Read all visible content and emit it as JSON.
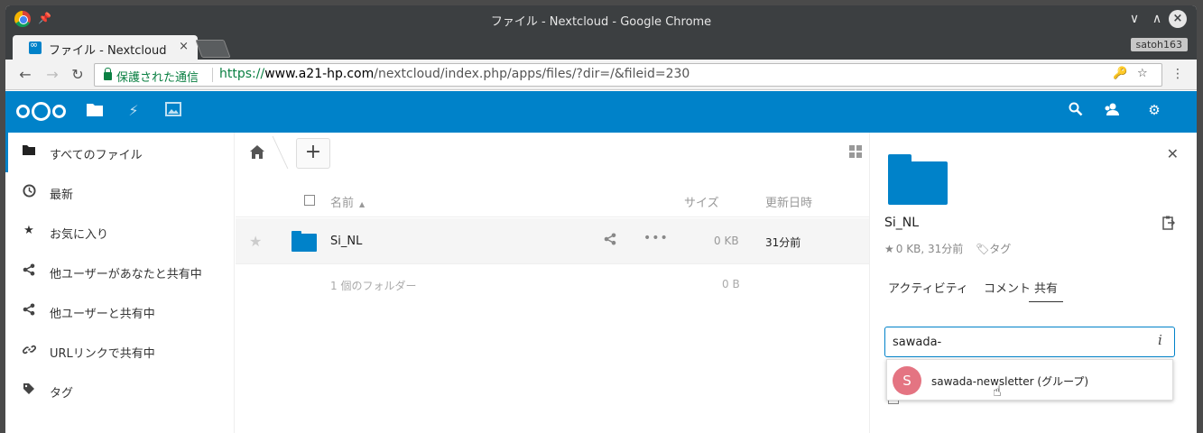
{
  "window": {
    "title": "ファイル - Nextcloud - Google Chrome",
    "controls": [
      "chevron-down",
      "chevron-up",
      "close"
    ]
  },
  "tab": {
    "title": "ファイル - Nextcloud",
    "close": "×"
  },
  "profile": "satoh163",
  "address": {
    "secure_label": "保護された通信",
    "scheme": "https://",
    "host": "www.a21-hp.com",
    "path": "/nextcloud/index.php/apps/files/?dir=/&fileid=230"
  },
  "nc_header": {
    "apps": [
      "files-icon",
      "activity-icon",
      "gallery-icon"
    ],
    "right": [
      "search-icon",
      "contacts-icon",
      "settings-icon"
    ],
    "brand_color": "#0082c9"
  },
  "sidebar": {
    "items": [
      {
        "label": "すべてのファイル",
        "icon": "folder-icon",
        "active": true
      },
      {
        "label": "最新",
        "icon": "clock-icon"
      },
      {
        "label": "お気に入り",
        "icon": "star-icon"
      },
      {
        "label": "他ユーザーがあなたと共有中",
        "icon": "share-icon"
      },
      {
        "label": "他ユーザーと共有中",
        "icon": "share-icon"
      },
      {
        "label": "URLリンクで共有中",
        "icon": "link-icon"
      },
      {
        "label": "タグ",
        "icon": "tag-icon"
      }
    ]
  },
  "files": {
    "add_label": "+",
    "columns": {
      "name": "名前",
      "size": "サイズ",
      "modified": "更新日時"
    },
    "rows": [
      {
        "name": "Si_NL",
        "size": "0 KB",
        "modified": "31分前"
      }
    ],
    "summary": {
      "count": "1 個のフォルダー",
      "total": "0 B"
    }
  },
  "details": {
    "name": "Si_NL",
    "meta": "0 KB, 31分前",
    "tag_label": "タグ",
    "tabs": [
      "アクティビティ",
      "コメント",
      "共有"
    ],
    "active_tab": "共有",
    "share_input_value": "sawada-",
    "suggestion": {
      "avatar_letter": "S",
      "label": "sawada-newsletter (グループ)"
    }
  }
}
